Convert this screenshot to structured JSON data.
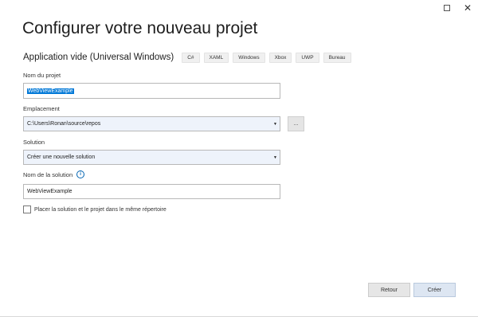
{
  "window": {
    "maximize_glyph": "",
    "close_glyph": "✕"
  },
  "page": {
    "title": "Configurer votre nouveau projet"
  },
  "template": {
    "name": "Application vide (Universal Windows)",
    "tags": [
      "C#",
      "XAML",
      "Windows",
      "Xbox",
      "UWP",
      "Bureau"
    ]
  },
  "project_name": {
    "label": "Nom du projet",
    "value": "WebViewExample"
  },
  "location": {
    "label": "Emplacement",
    "value": "C:\\Users\\Ronan\\source\\repos",
    "browse_label": "..."
  },
  "solution": {
    "label": "Solution",
    "value": "Créer une nouvelle solution"
  },
  "solution_name": {
    "label": "Nom de la solution",
    "info_glyph": "i",
    "value": "WebViewExample"
  },
  "same_dir": {
    "label": "Placer la solution et le projet dans le même répertoire",
    "checked": false
  },
  "footer": {
    "back_label": "Retour",
    "create_label": "Créer"
  },
  "colors": {
    "selection": "#0078d7",
    "combo_background": "#eef3fb",
    "info_icon": "#0063b1"
  }
}
